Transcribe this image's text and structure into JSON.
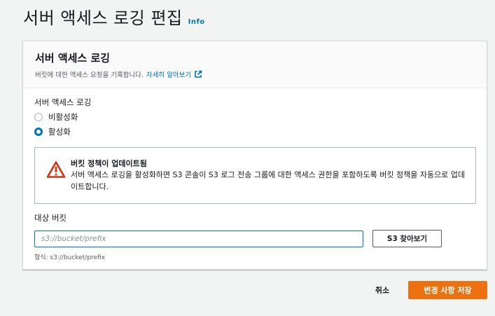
{
  "page": {
    "title": "서버 액세스 로깅 편집",
    "info_label": "Info"
  },
  "panel": {
    "title": "서버 액세스 로깅",
    "description": "버킷에 대한 액세스 요청을 기록합니다.",
    "learn_more": "자세히 알아보기",
    "learn_more_icon": "external-link-icon"
  },
  "logging": {
    "label": "서버 액세스 로깅",
    "options": [
      {
        "label": "비활성화",
        "selected": false
      },
      {
        "label": "활성화",
        "selected": true
      }
    ]
  },
  "warning": {
    "icon": "warning-triangle-icon",
    "title": "버킷 정책이 업데이트됨",
    "message": "서버 액세스 로깅을 활성화하면 S3 콘솔이 S3 로그 전송 그룹에 대한 액세스 권한을 포함하도록 버킷 정책을 자동으로 업데이트합니다."
  },
  "target_bucket": {
    "label": "대상 버킷",
    "placeholder": "s3://bucket/prefix",
    "value": "",
    "browse_label": "S3 찾아보기",
    "format_hint": "형식: s3://bucket/prefix"
  },
  "actions": {
    "cancel_label": "취소",
    "save_label": "변경 사항 저장"
  },
  "colors": {
    "accent": "#0073bb",
    "primary_button": "#ec7211",
    "warning": "#d13212"
  }
}
